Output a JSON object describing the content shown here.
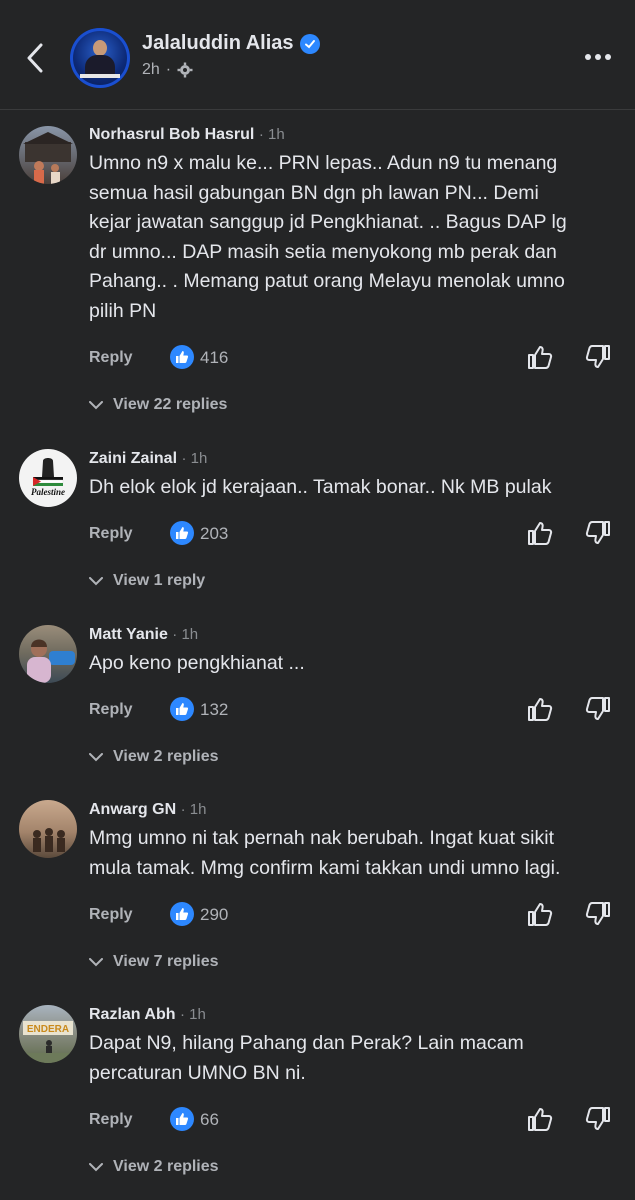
{
  "header": {
    "page_name": "Jalaluddin Alias",
    "post_time": "2h",
    "icons": {
      "back": "chevron-left-icon",
      "verified": "verified-badge-icon",
      "privacy": "gear-icon",
      "more": "more-horizontal-icon"
    }
  },
  "labels": {
    "reply": "Reply"
  },
  "comments": [
    {
      "name": "Norhasrul Bob Hasrul",
      "time": "· 1h",
      "text_lines": [
        "Umno n9 x malu ke... PRN lepas.. Adun n9 tu menang",
        "semua hasil gabungan BN dgn ph lawan PN... Demi",
        "kejar jawatan sanggup jd Pengkhianat. .. Bagus DAP lg",
        "dr umno... DAP masih setia menyokong mb perak dan",
        "Pahang.. . Memang patut orang Melayu menolak umno",
        "pilih PN"
      ],
      "likes": "416",
      "replies": "View 22 replies"
    },
    {
      "name": "Zaini Zainal",
      "time": "· 1h",
      "avatar_text": "Palestine",
      "text_lines": [
        "Dh elok elok jd kerajaan.. Tamak bonar.. Nk MB pulak"
      ],
      "likes": "203",
      "replies": "View 1 reply"
    },
    {
      "name": "Matt Yanie",
      "time": "· 1h",
      "text_lines": [
        "Apo keno pengkhianat ..."
      ],
      "likes": "132",
      "replies": "View 2 replies"
    },
    {
      "name": "Anwarg GN",
      "time": "· 1h",
      "text_lines": [
        "Mmg umno ni tak pernah nak berubah. Ingat kuat sikit",
        "mula tamak. Mmg confirm kami takkan undi umno lagi."
      ],
      "likes": "290",
      "replies": "View 7 replies"
    },
    {
      "name": "Razlan Abh",
      "time": "· 1h",
      "avatar_text": "ENDERA",
      "text_lines": [
        "Dapat N9, hilang Pahang dan Perak? Lain macam",
        "percaturan UMNO BN ni."
      ],
      "likes": "66",
      "replies": "View 2 replies"
    }
  ],
  "colors": {
    "background": "#242526",
    "text_primary": "#e4e6eb",
    "text_secondary": "#b0b3b8",
    "like_blue": "#2d88ff"
  }
}
